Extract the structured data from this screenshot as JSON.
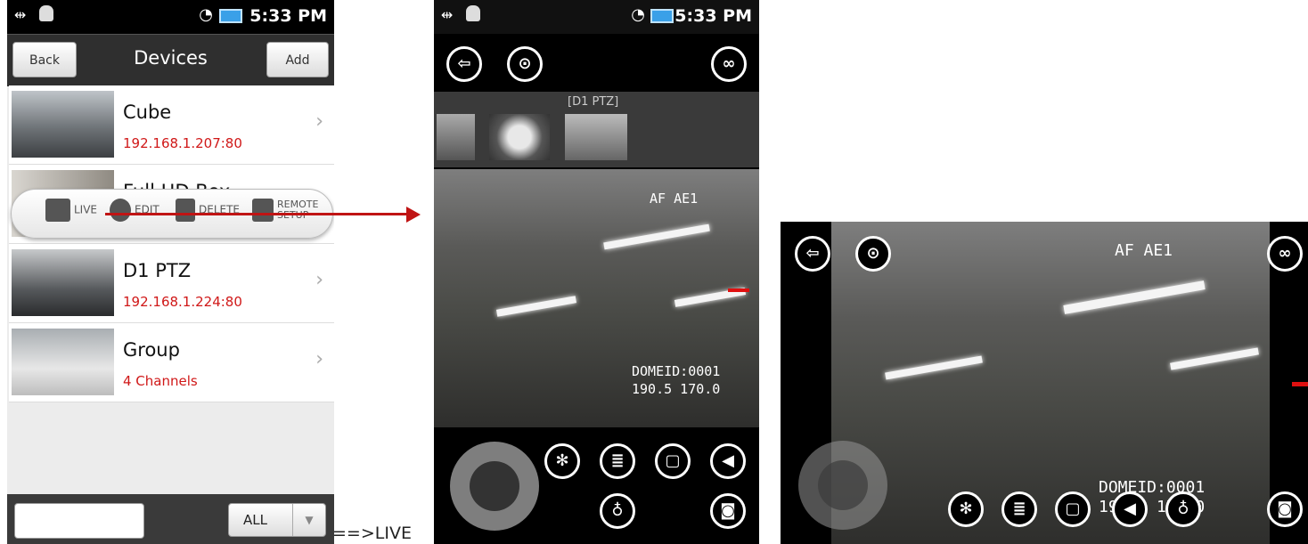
{
  "status_bar": {
    "time": "5:33 PM"
  },
  "devices_screen": {
    "title": "Devices",
    "back_label": "Back",
    "add_label": "Add",
    "devices": [
      {
        "name": "Cube",
        "address": "192.168.1.207:80"
      },
      {
        "name": "Full HD Box",
        "address": ""
      },
      {
        "name": "D1 PTZ",
        "address": "192.168.1.224:80"
      },
      {
        "name": "Group",
        "address": "4 Channels"
      }
    ],
    "context_menu": {
      "live": "LIVE",
      "edit": "EDIT",
      "delete": "DELETE",
      "remote_setup": "REMOTE SETUP"
    },
    "filter_value": "ALL"
  },
  "live_screen": {
    "channel_label": "[D1 PTZ]",
    "osd_top": "AF AE1",
    "osd_id": "DOMEID:0001",
    "osd_coords": "190.5 170.0"
  },
  "caption": "==>LIVE",
  "colors": {
    "accent_red": "#d01818",
    "arrow": "#c01414"
  }
}
